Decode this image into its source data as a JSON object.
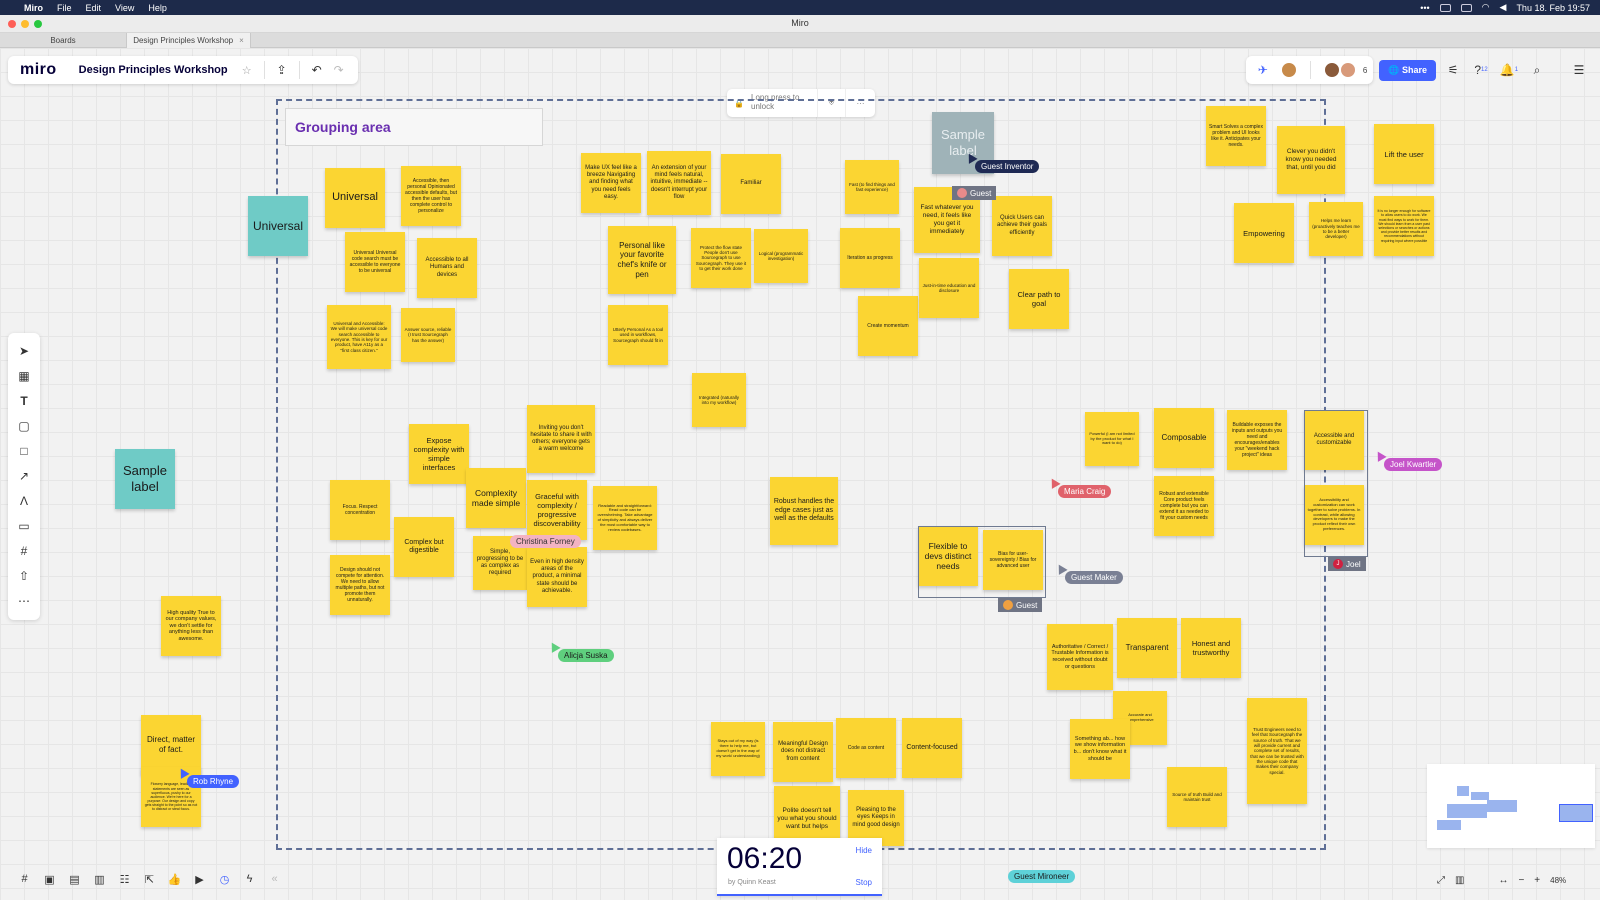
{
  "menubar": {
    "app": "Miro",
    "menus": [
      "File",
      "Edit",
      "View",
      "Help"
    ],
    "datetime": "Thu 18. Feb 19:57"
  },
  "window": {
    "title": "Miro"
  },
  "tabs": [
    {
      "label": "Boards"
    },
    {
      "label": "Design Principles Workshop",
      "close": "×"
    }
  ],
  "header": {
    "logo": "miro",
    "board_title": "Design Principles Workshop",
    "star": "☆",
    "collaborator_count": "6",
    "share_label": "Share",
    "help_badge": "12",
    "notif_badge": "1"
  },
  "lock": {
    "text": "Long press to unlock",
    "more": "···"
  },
  "frame": {
    "title": "Grouping area"
  },
  "stickies": [
    {
      "id": "universal-teal",
      "text": "Universal",
      "color": "teal"
    },
    {
      "id": "sample-label-left",
      "text": "Sample label",
      "color": "teal"
    },
    {
      "id": "sample-label-top",
      "text": "Sample label",
      "color": "grey"
    },
    {
      "id": "universal",
      "text": "Universal"
    },
    {
      "id": "accessible-personal",
      "text": "Accessible, then personal Opinionated accessible defaults, but then the user has complete control to personalize"
    },
    {
      "id": "universal-code",
      "text": "Universal Universal code search must be accessible to everyone to be universal"
    },
    {
      "id": "accessible-all",
      "text": "Accessible to all Humans and devices"
    },
    {
      "id": "universal-accessible",
      "text": "Universal and Accessible: We will make universal code search accessible to everyone. This is key for our product, have A11y as a \"first class citizen.\""
    },
    {
      "id": "answer-source",
      "text": "Answer source, reliable (I trust Sourcegraph has the answer)"
    },
    {
      "id": "make-ux",
      "text": "Make UX feel like a breeze Navigating and finding what you need feels easy."
    },
    {
      "id": "extension-mind",
      "text": "An extension of your mind feels natural, intuitive, immediate -- doesn't interrupt your flow"
    },
    {
      "id": "familiar",
      "text": "Familiar"
    },
    {
      "id": "personal-knife",
      "text": "Personal like your favorite chef's knife or pen"
    },
    {
      "id": "protect-flow",
      "text": "Protect the flow state People don't use Sourcegraph to use Sourcegraph. They use it to get their work done"
    },
    {
      "id": "logical",
      "text": "Logical (programmatic investigation)"
    },
    {
      "id": "utterly-personal",
      "text": "Utterly Personal As a tool used in workflows, Sourcegraph should fit in"
    },
    {
      "id": "integrated",
      "text": "Integrated (naturally into my workflow)"
    },
    {
      "id": "fast-small",
      "text": "Fast (to find things and fast experience)"
    },
    {
      "id": "iteration",
      "text": "Iteration as progress"
    },
    {
      "id": "create-momentum",
      "text": "Create momentum"
    },
    {
      "id": "fast-immediately",
      "text": "Fast whatever you need, it feels like you get it immediately"
    },
    {
      "id": "quick",
      "text": "Quick Users can achieve their goals efficiently"
    },
    {
      "id": "just-in-time",
      "text": "Just-in-time education and disclosure"
    },
    {
      "id": "clear-path",
      "text": "Clear path to goal"
    },
    {
      "id": "smart",
      "text": "Smart Solves a complex problem and UI looks like it. Anticipates your needs."
    },
    {
      "id": "clever",
      "text": "Clever you didn't know you needed that, until you did"
    },
    {
      "id": "lift-user",
      "text": "Lift the user"
    },
    {
      "id": "empowering",
      "text": "Empowering"
    },
    {
      "id": "helps-learn",
      "text": "Helps me learn (proactively teaches me to be a better developer)"
    },
    {
      "id": "no-longer",
      "text": "It is no longer enough for software to allow users to do work. We must find ways to work for them. We should learn from a user past selections or searches or actions and provide better results and recommendations without requiring input where possible"
    },
    {
      "id": "inviting",
      "text": "Inviting you don't hesitate to share it with others; everyone gets a warm welcome"
    },
    {
      "id": "expose-complexity",
      "text": "Expose complexity with simple interfaces"
    },
    {
      "id": "focus-respect",
      "text": "Focus. Respect concentration"
    },
    {
      "id": "complexity-simple",
      "text": "Complexity made simple"
    },
    {
      "id": "graceful",
      "text": "Graceful with complexity / progressive discoverability"
    },
    {
      "id": "readable",
      "text": "Readable and straightforward: Read code can be overwhelming. Take advantage of simplicity and always deliver the most comfortable way to review codebases."
    },
    {
      "id": "complex-digestible",
      "text": "Complex but digestible"
    },
    {
      "id": "design-not-compete",
      "text": "Design should not compete for attention. We need to allow multiple paths, but not promote them unnaturally."
    },
    {
      "id": "simple-progressing",
      "text": "Simple, progressing to be as complex as required"
    },
    {
      "id": "high-density",
      "text": "Even in high density areas of the product, a minimal state should be achievable."
    },
    {
      "id": "robust",
      "text": "Robust handles the edge cases just as well as the defaults"
    },
    {
      "id": "high-quality",
      "text": "High quality True to our company values, we don't settle for anything less than awesome."
    },
    {
      "id": "direct",
      "text": "Direct, matter of fact."
    },
    {
      "id": "flowery",
      "text": "Flowery language, leading statements are seen as superfluous, pushy to our audience. We're here for a purpose: Our design and copy gets straight to the point so as not to distract or steal focus."
    },
    {
      "id": "flexible",
      "text": "Flexible to devs distinct needs"
    },
    {
      "id": "bias-user",
      "text": "Bias for user-sovereignty / Bias for advanced user"
    },
    {
      "id": "powerful",
      "text": "Powerful (I am not limited by the product for what I want to do)"
    },
    {
      "id": "composable",
      "text": "Composable"
    },
    {
      "id": "buildable",
      "text": "Buildable exposes the inputs and outputs you need and encourages/enables your \"weekend hack project\" ideas"
    },
    {
      "id": "accessible-customizable",
      "text": "Accessible and customizable"
    },
    {
      "id": "robust-extensible",
      "text": "Robust and extensible Core product feels complete but you can extend it as needed to fit your custom needs"
    },
    {
      "id": "accessibility-custom",
      "text": "Accessibility and customization can work together to solve problems. In contrast, while allowing developers to make the product reflect their own preferences."
    },
    {
      "id": "authoritative",
      "text": "Authoritative / Correct / Trustable Information is received without doubt or questions"
    },
    {
      "id": "transparent",
      "text": "Transparent"
    },
    {
      "id": "honest",
      "text": "Honest and trustworthy"
    },
    {
      "id": "accurate",
      "text": "Accurate and comprehensive"
    },
    {
      "id": "something-ab",
      "text": "Something ab... how we show information b... don't know what it should be"
    },
    {
      "id": "trust",
      "text": "Trust Engineers need to feel that Sourcegraph the source of truth. That we will provide current and complete set of results, that we can be trusted with the unique code that makes their company special."
    },
    {
      "id": "source-truth",
      "text": "Source of truth Build and maintain trust"
    },
    {
      "id": "stays-out",
      "text": "Stays out of my way (is there to help me, but doesn't get in the way of my work/ understanding)"
    },
    {
      "id": "meaningful",
      "text": "Meaningful Design does not distract from content"
    },
    {
      "id": "code-content",
      "text": "Code as content"
    },
    {
      "id": "content-focused",
      "text": "Content-focused"
    },
    {
      "id": "polite",
      "text": "Polite doesn't tell you what you should want but helps"
    },
    {
      "id": "pleasing",
      "text": "Pleasing to the eyes Keeps in mind good design"
    }
  ],
  "cursors": [
    {
      "id": "guest-inventor",
      "label": "Guest Inventor",
      "color": "#1f2a54"
    },
    {
      "id": "guest-top",
      "label": "Guest",
      "color": "#6f7484"
    },
    {
      "id": "christina",
      "label": "Christina Forney",
      "color": "#f3b3c2"
    },
    {
      "id": "alicja",
      "label": "Alicja Suska",
      "color": "#5fcf7e"
    },
    {
      "id": "rob",
      "label": "Rob Rhyne",
      "color": "#4262ff"
    },
    {
      "id": "maria",
      "label": "Maria Craig",
      "color": "#e0626b"
    },
    {
      "id": "joel-k",
      "label": "Joel Kwartler",
      "color": "#c554c9"
    },
    {
      "id": "guest-maker",
      "label": "Guest Maker",
      "color": "#7a8094"
    },
    {
      "id": "guest-mironeer",
      "label": "Guest Mironeer",
      "color": "#5ed1d8"
    }
  ],
  "tags": {
    "guest_flex": "Guest",
    "joel": "Joel",
    "joel_initial": "J"
  },
  "timer": {
    "time": "06:20",
    "by": "by Quinn Keast",
    "hide": "Hide",
    "stop": "Stop"
  },
  "zoom": {
    "level": "48%"
  },
  "colors": {
    "accent": "#4262ff",
    "sticky": "#fbd532",
    "teal": "#6fcbc6"
  }
}
